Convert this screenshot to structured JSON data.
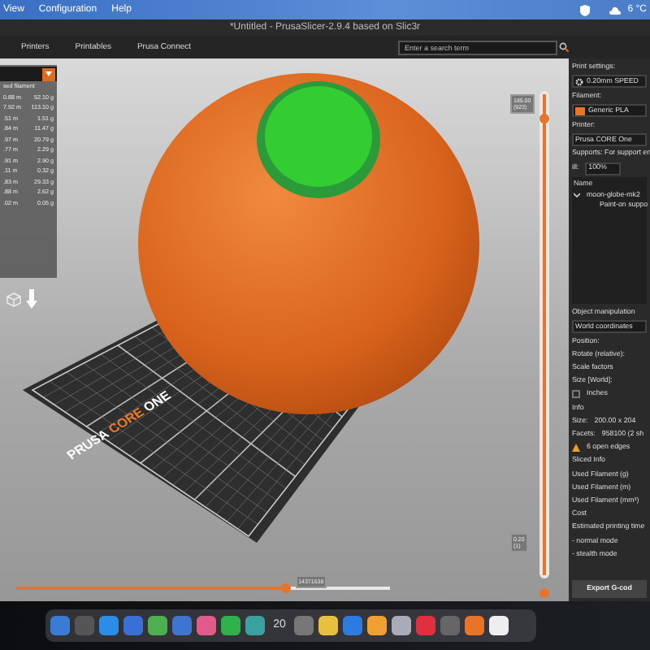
{
  "menu_bar": {
    "items": [
      "View",
      "Configuration",
      "Help"
    ],
    "weather": "6 °C"
  },
  "window": {
    "title": "*Untitled - PrusaSlicer-2.9.4 based on Slic3r"
  },
  "tabs": [
    {
      "label": "Printers",
      "selected": false
    },
    {
      "label": "Printables",
      "selected": false
    },
    {
      "label": "Prusa Connect",
      "selected": false
    }
  ],
  "search": {
    "placeholder": "Enter a search term"
  },
  "legend": {
    "header": "sed filament",
    "rows": [
      [
        "0.88 m",
        "52.10 g"
      ],
      [
        "7.92 m",
        "113.10 g"
      ],
      [
        ".51 m",
        "1.51 g"
      ],
      [
        ".84 m",
        "11.47 g"
      ],
      [
        ".97 m",
        "20.79 g"
      ],
      [
        ".77 m",
        "2.29 g"
      ],
      [
        ".91 m",
        "2.90 g"
      ],
      [
        ".11 m",
        "0.32 g"
      ],
      [
        ".83 m",
        "29.33 g"
      ],
      [
        ".88 m",
        "2.62 g"
      ],
      [
        ".02 m",
        "0.05 g"
      ]
    ]
  },
  "bed_logo": [
    "PRUSA",
    "CORE",
    "ONE"
  ],
  "vertical_slider": {
    "top_label": "185.00\n(923)",
    "bottom_label": "0.20\n(1)",
    "level": 1
  },
  "horizontal_slider": {
    "label": "14371638",
    "level": 0.72
  },
  "sidebar": {
    "print_settings_label": "Print settings:",
    "print_profile": "0.20mm SPEED",
    "filament_label": "Filament:",
    "filament": "Generic PLA",
    "printer_label": "Printer:",
    "printer": "Prusa CORE One",
    "supports": "Supports: For support en",
    "infill_label": "ill:",
    "infill": "100%",
    "name_header": "Name",
    "objects": [
      {
        "name": "moon-globe-mk2",
        "expanded": true,
        "children": [
          {
            "name": "Paint-on suppo"
          }
        ]
      }
    ],
    "manipulation": {
      "title": "Object manipulation",
      "coordinates": "World coordinates",
      "position": "Position:",
      "rotate": "Rotate (relative):",
      "scale": "Scale factors",
      "size": "Size [World]:",
      "inches": "Inches",
      "inches_checked": false
    },
    "info": {
      "title": "Info",
      "size_label": "Size:",
      "size": "200.00 x 204",
      "facets_label": "Facets:",
      "facets": "958100 (2 sh",
      "warning": "6 open edges"
    },
    "sliced_info": {
      "title": "Sliced Info",
      "rows": [
        "Used Filament (g)",
        "Used Filament (m)",
        "Used Filament (mm³)",
        "Cost",
        "Estimated printing time",
        "- normal mode",
        "- stealth mode"
      ]
    },
    "export_button": "Export G-cod"
  },
  "dock": {
    "calendar_day": "20"
  }
}
